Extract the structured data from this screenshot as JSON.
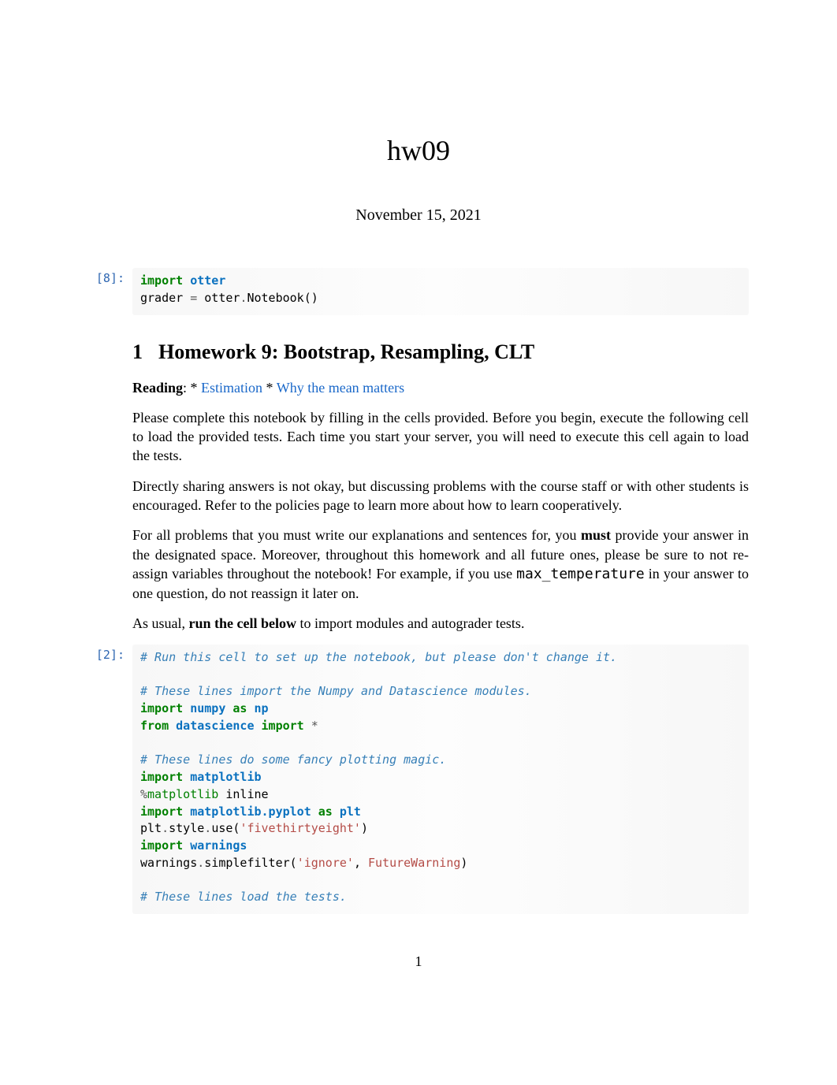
{
  "title": "hw09",
  "date": "November 15, 2021",
  "cells": {
    "c1": {
      "prompt": "[8]:",
      "lines": {
        "l1": {
          "import": "import",
          "mod": "otter"
        },
        "l2": {
          "lhs": "grader ",
          "op": "=",
          "rhs": " otter",
          "dot": ".",
          "call": "Notebook()"
        }
      }
    },
    "c2": {
      "prompt": "[2]:",
      "lines": {
        "l1": "# Run this cell to set up the notebook, but please don't change it.",
        "l2": "",
        "l3": "# These lines import the Numpy and Datascience modules.",
        "l4": {
          "import": "import",
          "mod": "numpy",
          "as": "as",
          "alias": "np"
        },
        "l5": {
          "from": "from",
          "mod": "datascience",
          "import": "import",
          "star": "*"
        },
        "l6": "",
        "l7": "# These lines do some fancy plotting magic.",
        "l8": {
          "import": "import",
          "mod": "matplotlib"
        },
        "l9": {
          "magic": "%",
          "mod": "matplotlib",
          "txt": " inline"
        },
        "l10": {
          "import": "import",
          "mod": "matplotlib.pyplot",
          "as": "as",
          "alias": "plt"
        },
        "l11": {
          "a": "plt",
          "d1": ".",
          "b": "style",
          "d2": ".",
          "c": "use(",
          "str": "'fivethirtyeight'",
          "e": ")"
        },
        "l12": {
          "import": "import",
          "mod": "warnings"
        },
        "l13": {
          "a": "warnings",
          "d1": ".",
          "b": "simplefilter(",
          "str": "'ignore'",
          "comma": ", ",
          "exc": "FutureWarning",
          "e": ")"
        },
        "l14": "",
        "l15": "# These lines load the tests."
      }
    }
  },
  "section": {
    "num": "1",
    "title": "Homework 9: Bootstrap, Resampling, CLT"
  },
  "reading": {
    "prefix": "Reading",
    "colon": ": *",
    "link1": "Estimation",
    "mid": " * ",
    "link2": "Why the mean matters"
  },
  "paras": {
    "p1": "Please complete this notebook by filling in the cells provided. Before you begin, execute the following cell to load the provided tests. Each time you start your server, you will need to execute this cell again to load the tests.",
    "p2": "Directly sharing answers is not okay, but discussing problems with the course staff or with other students is encouraged. Refer to the policies page to learn more about how to learn cooperatively.",
    "p3a": "For all problems that you must write our explanations and sentences for, you ",
    "p3must": "must",
    "p3b": " provide your answer in the designated space. Moreover, throughout this homework and all future ones, please be sure to not re-assign variables throughout the notebook! For example, if you use ",
    "p3code": "max_temperature",
    "p3c": " in your answer to one question, do not reassign it later on.",
    "p4a": "As usual, ",
    "p4b": "run the cell below",
    "p4c": " to import modules and autograder tests."
  },
  "page_number": "1"
}
